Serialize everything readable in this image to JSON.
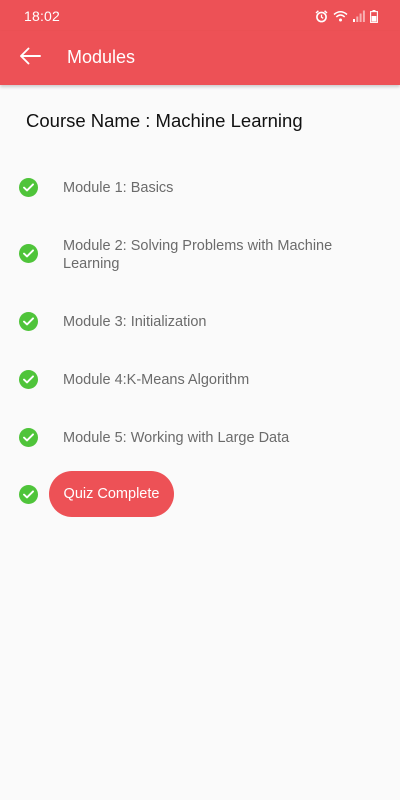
{
  "status_bar": {
    "time": "18:02",
    "icons": [
      "alarm-icon",
      "wifi-icon",
      "signal-icon",
      "battery-icon"
    ]
  },
  "app_bar": {
    "back_icon": "arrow-left-icon",
    "title": "Modules"
  },
  "course": {
    "name_text": "Course Name : Machine Learning"
  },
  "modules": [
    {
      "label": "Module 1: Basics",
      "completed": true
    },
    {
      "label": "Module 2: Solving Problems with Machine Learning",
      "completed": true
    },
    {
      "label": "Module 3: Initialization",
      "completed": true
    },
    {
      "label": "Module 4:K-Means Algorithm",
      "completed": true
    },
    {
      "label": "Module 5: Working with Large Data",
      "completed": true
    }
  ],
  "quiz": {
    "completed": true,
    "button_label": "Quiz Complete"
  },
  "colors": {
    "primary": "#ed5156",
    "check": "#4fc43a",
    "background": "#fafafa",
    "module_text": "#6b6b6b"
  }
}
